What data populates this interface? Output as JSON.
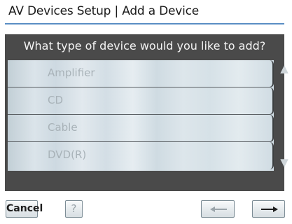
{
  "title": "AV Devices Setup | Add a Device",
  "prompt": "What type of device would you like to add?",
  "devices": [
    "Amplifier",
    "CD",
    "Cable",
    "DVD(R)"
  ],
  "scroll": {
    "up_icon": "▲",
    "down_icon": "▼"
  },
  "buttons": {
    "cancel": "Cancel",
    "help": "?",
    "back_icon": "left-arrow-icon",
    "next_icon": "right-arrow-icon"
  },
  "colors": {
    "accent_rule": "#5a8ec4",
    "panel": "#4a4a4a",
    "list_text": "#a8b2b8"
  }
}
